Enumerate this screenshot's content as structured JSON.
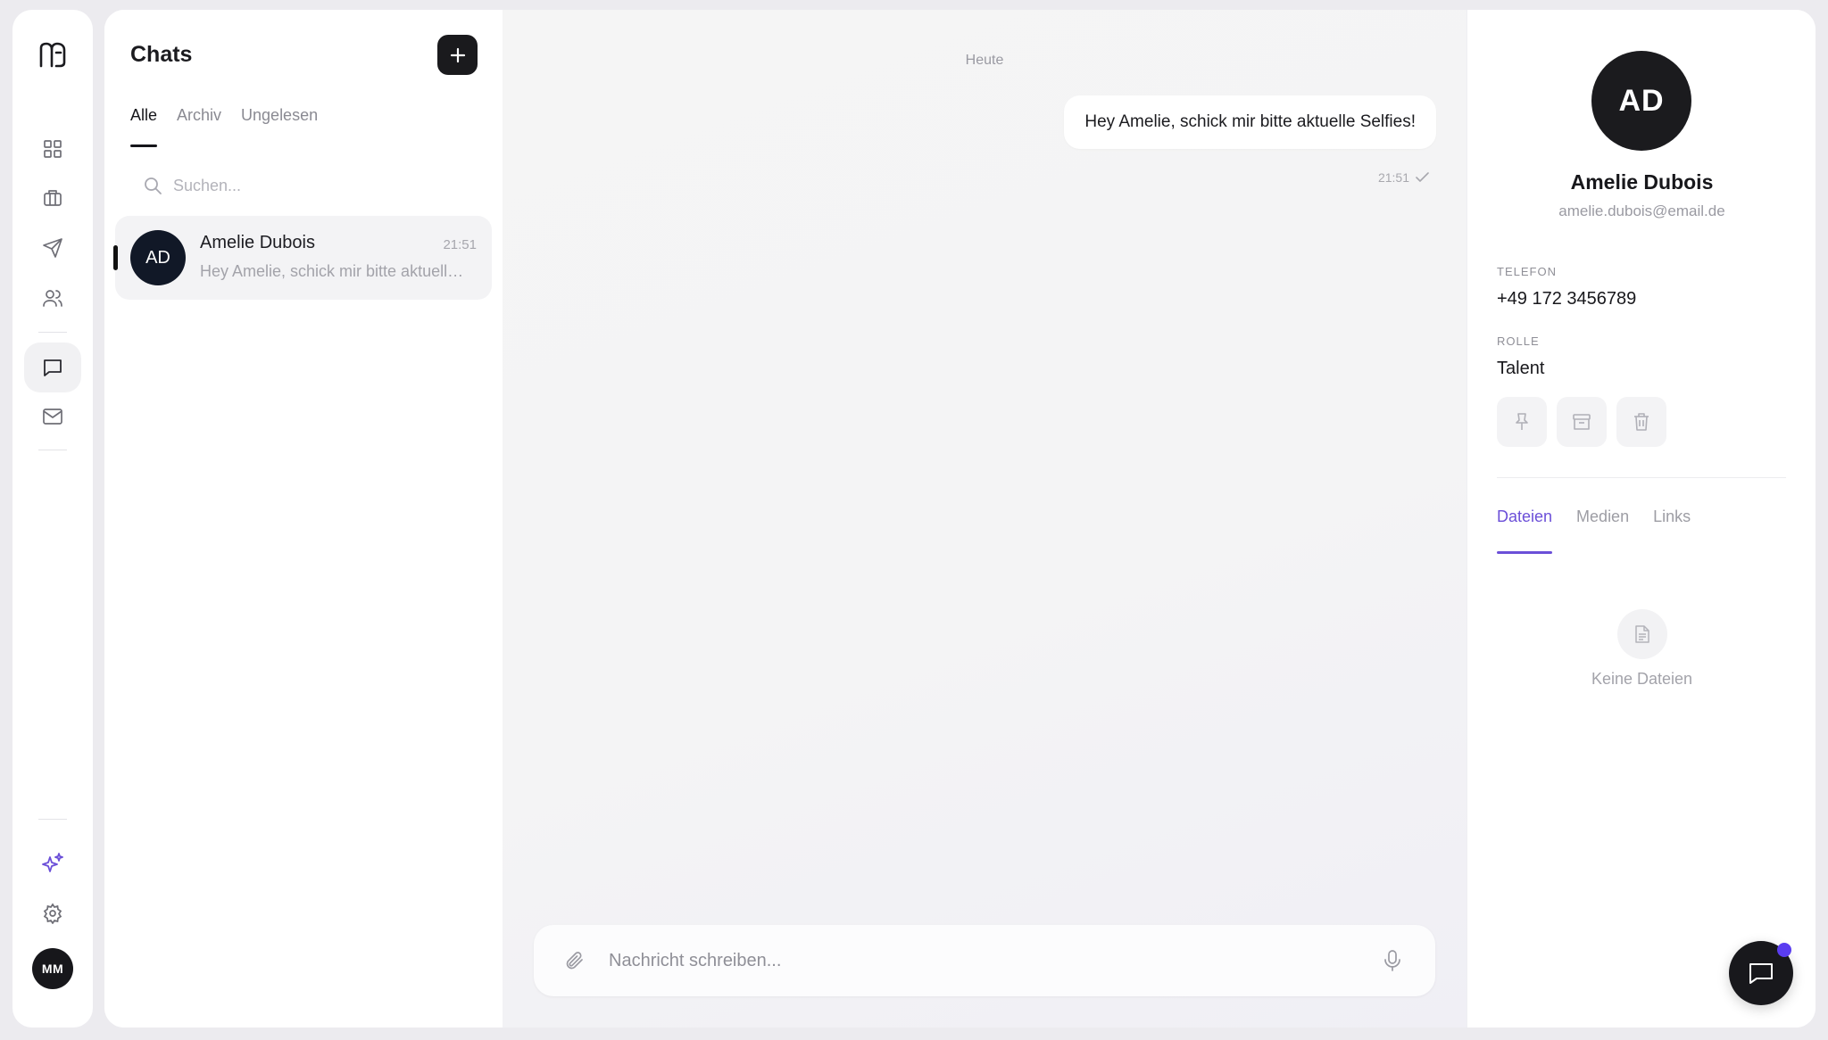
{
  "rail": {
    "logo_icon": "brand-logo-icon",
    "nav": [
      {
        "id": "dashboard",
        "icon": "grid-icon"
      },
      {
        "id": "jobs",
        "icon": "briefcase-icon"
      },
      {
        "id": "send",
        "icon": "paper-plane-icon"
      },
      {
        "id": "contacts",
        "icon": "users-icon"
      },
      {
        "id": "chats",
        "icon": "chat-icon",
        "active": true
      },
      {
        "id": "mail",
        "icon": "mail-icon"
      },
      {
        "id": "ai",
        "icon": "sparkles-icon"
      },
      {
        "id": "settings",
        "icon": "gear-icon"
      }
    ],
    "user_initials": "MM"
  },
  "chat_list": {
    "title": "Chats",
    "tabs": [
      {
        "label": "Alle",
        "active": true
      },
      {
        "label": "Archiv",
        "active": false
      },
      {
        "label": "Ungelesen",
        "active": false
      }
    ],
    "search_placeholder": "Suchen...",
    "items": [
      {
        "initials": "AD",
        "name": "Amelie Dubois",
        "time": "21:51",
        "preview": "Hey Amelie, schick mir bitte aktuelle Selfies!"
      }
    ]
  },
  "conversation": {
    "day_label": "Heute",
    "messages": [
      {
        "text": "Hey Amelie, schick mir bitte aktuelle Selfies!",
        "time": "21:51",
        "status": "sent"
      }
    ],
    "composer_placeholder": "Nachricht schreiben..."
  },
  "profile": {
    "initials": "AD",
    "name": "Amelie Dubois",
    "email": "amelie.dubois@email.de",
    "phone_label": "TELEFON",
    "phone": "+49 172 3456789",
    "role_label": "ROLLE",
    "role": "Talent",
    "tabs": [
      {
        "label": "Dateien",
        "active": true
      },
      {
        "label": "Medien",
        "active": false
      },
      {
        "label": "Links",
        "active": false
      }
    ],
    "empty_text": "Keine Dateien"
  },
  "colors": {
    "accent": "#6b4fd8",
    "dark": "#18181c",
    "notification_dot": "#5a3df0"
  }
}
